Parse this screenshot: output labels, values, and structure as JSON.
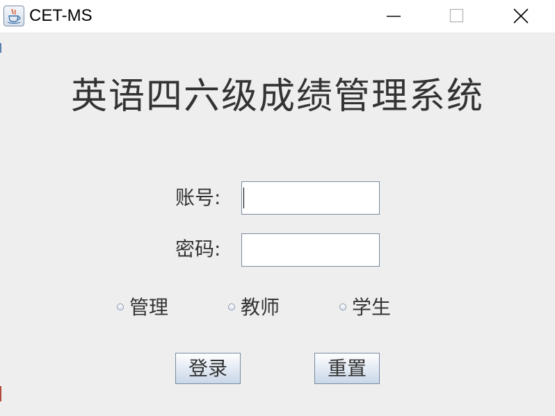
{
  "window": {
    "title": "CET-MS"
  },
  "header": {
    "heading": "英语四六级成绩管理系统"
  },
  "form": {
    "account_label": "账号:",
    "account_value": "",
    "password_label": "密码:",
    "password_value": ""
  },
  "roles": [
    {
      "label": "管理",
      "selected": false
    },
    {
      "label": "教师",
      "selected": false
    },
    {
      "label": "学生",
      "selected": false
    }
  ],
  "buttons": {
    "login": "登录",
    "reset": "重置"
  },
  "icons": {
    "app": "java-cup-icon",
    "minimize": "minimize-icon",
    "maximize": "maximize-icon",
    "close": "close-icon"
  },
  "colors": {
    "background": "#eeeeee",
    "titlebar": "#ffffff",
    "text": "#333333",
    "input_border": "#7a8aa0"
  }
}
